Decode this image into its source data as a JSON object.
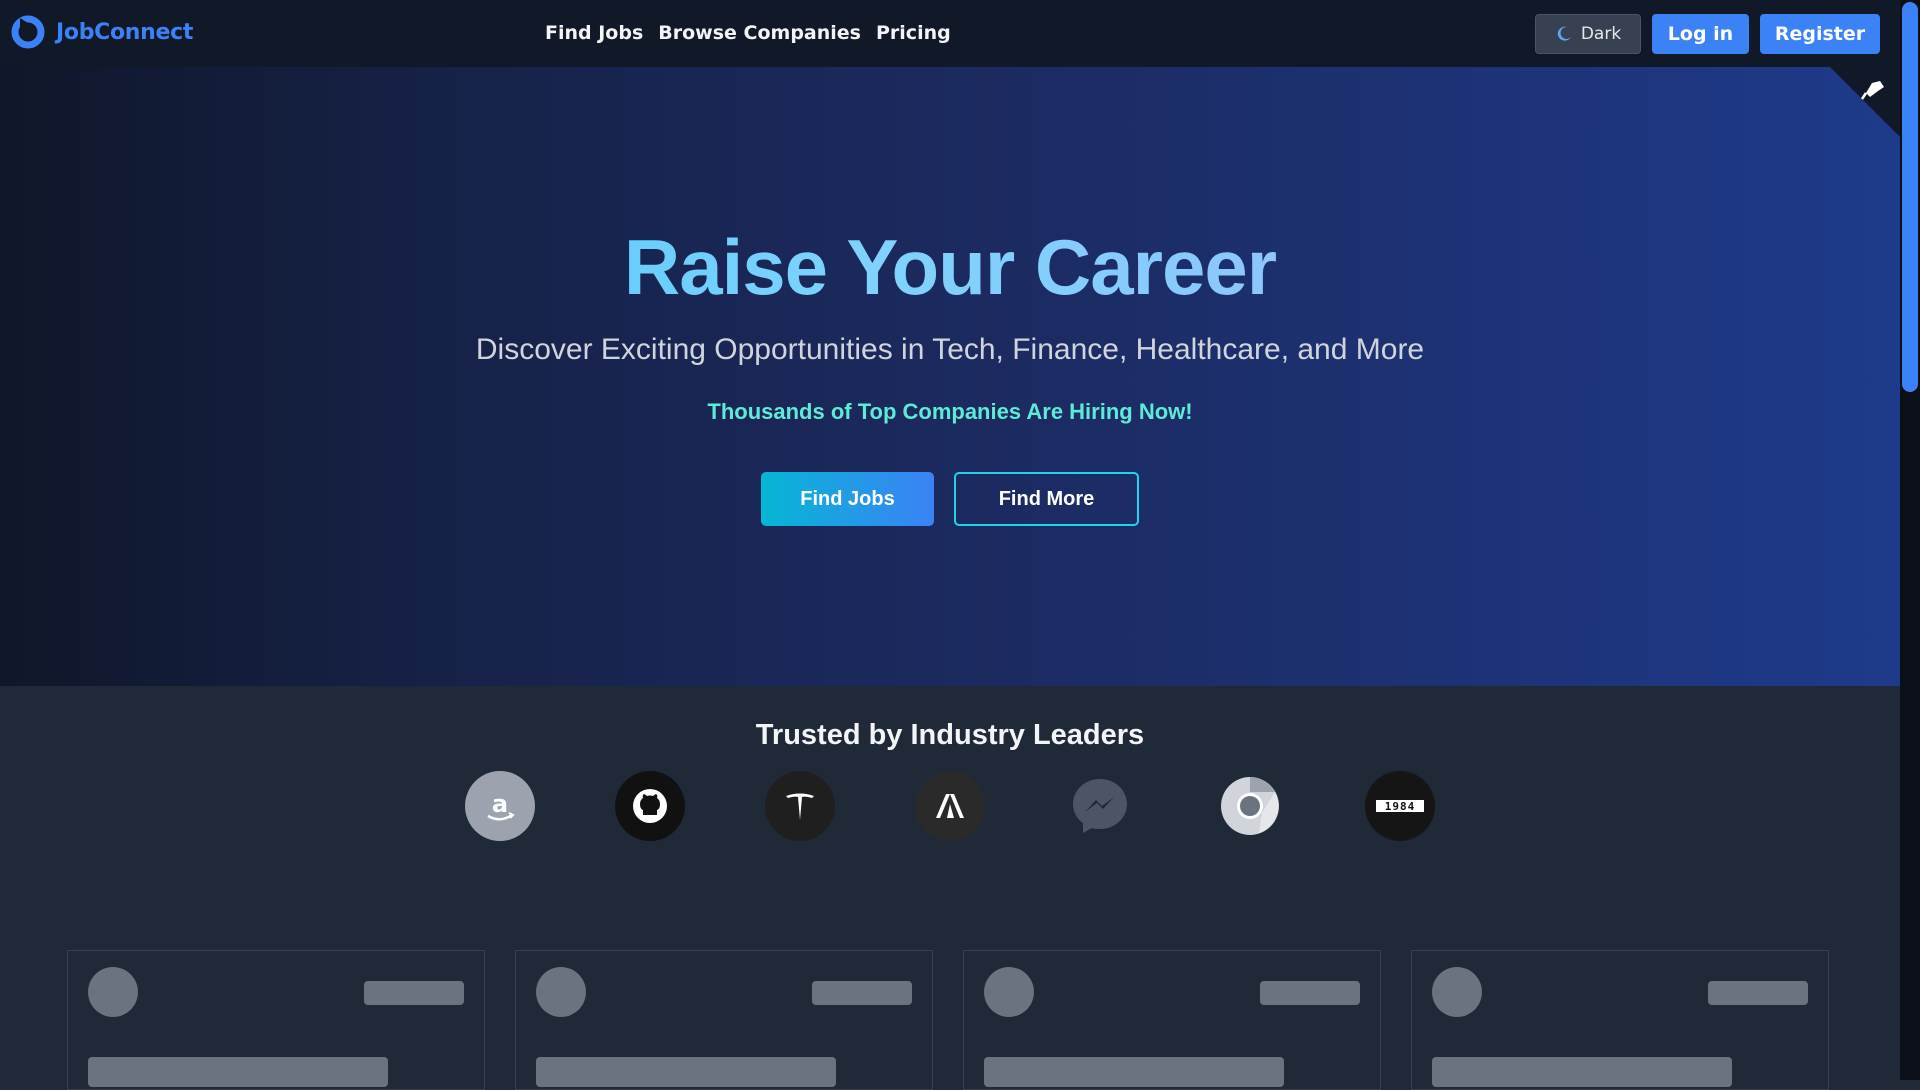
{
  "nav": {
    "brand": "JobConnect",
    "links": [
      "Find Jobs",
      "Browse Companies",
      "Pricing"
    ],
    "theme_toggle": "Dark",
    "login": "Log in",
    "register": "Register",
    "brand_color": "#3b82f6"
  },
  "hero": {
    "title": "Raise Your Career",
    "subtitle": "Discover Exciting Opportunities in Tech, Finance, Healthcare, and More",
    "tagline": "Thousands of Top Companies Are Hiring Now!",
    "primary_button": "Find Jobs",
    "secondary_button": "Find More"
  },
  "trusted": {
    "title": "Trusted by Industry Leaders",
    "logos": [
      "amazon-icon",
      "github-icon",
      "tesla-icon",
      "adobe-icon",
      "messenger-icon",
      "chrome-icon",
      "1984-icon"
    ],
    "numbers_logo_text": "1984"
  },
  "cards": {
    "count": 4,
    "state": "loading-skeleton"
  },
  "colors": {
    "accent": "#3b82f6",
    "cyan": "#22d3ee",
    "hero_title_gradient": [
      "#38bdf8",
      "#a5b4fc"
    ]
  }
}
